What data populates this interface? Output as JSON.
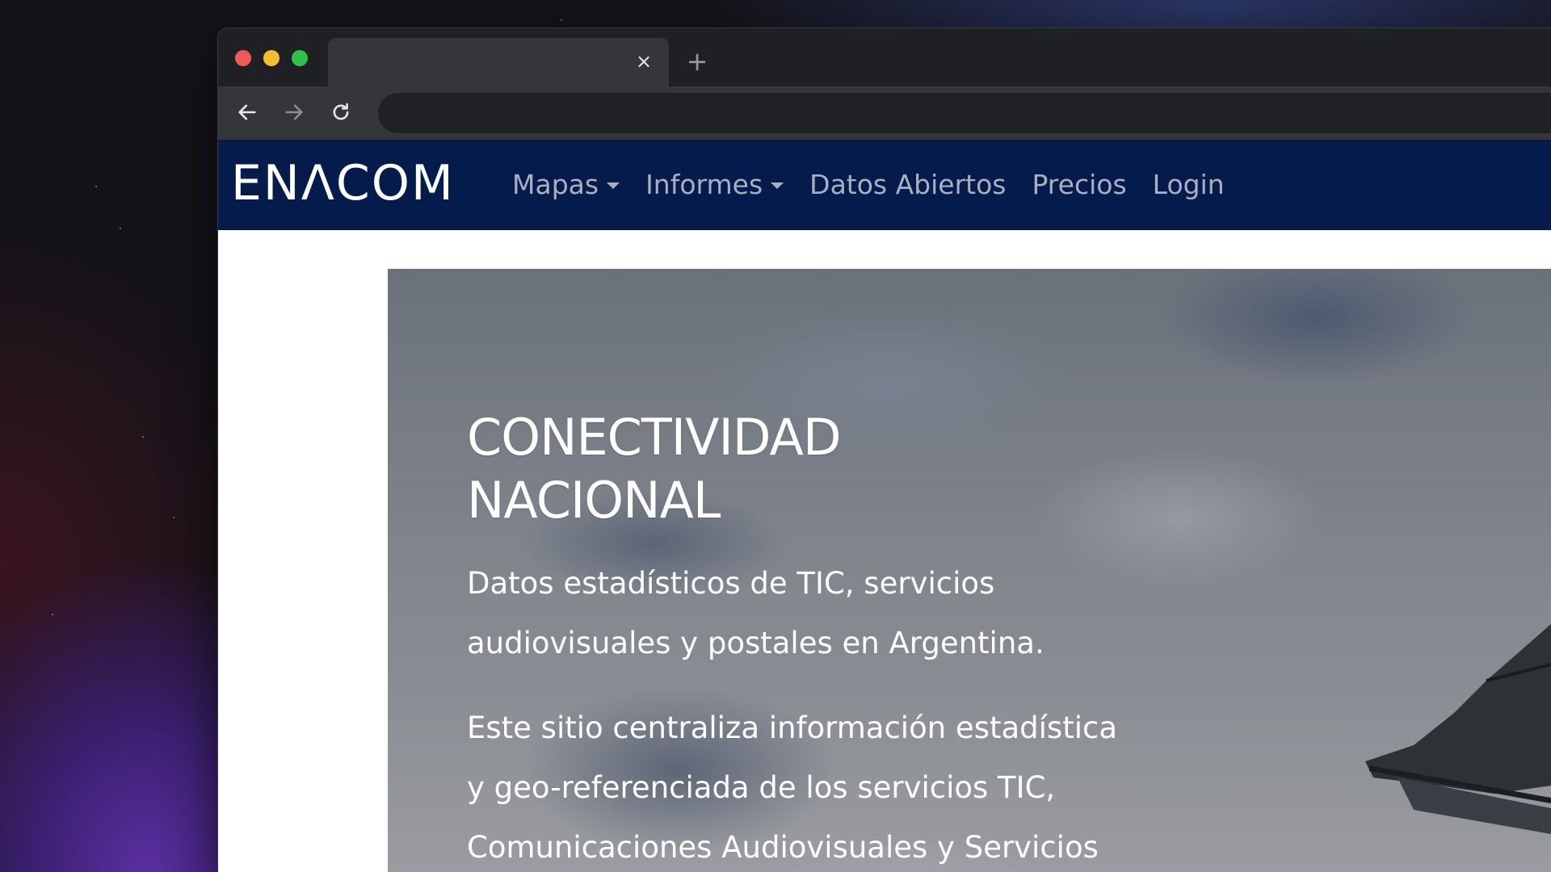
{
  "browser": {
    "tab_close": "×",
    "new_tab": "+"
  },
  "site": {
    "logo_text": "ENΛCOM",
    "nav": {
      "items": [
        {
          "label": "Mapas",
          "dropdown": true
        },
        {
          "label": "Informes",
          "dropdown": true
        },
        {
          "label": "Datos Abiertos",
          "dropdown": false
        },
        {
          "label": "Precios",
          "dropdown": false
        },
        {
          "label": "Login",
          "dropdown": false
        }
      ]
    },
    "hero": {
      "title_line1": "CONECTIVIDAD",
      "title_line2": "NACIONAL",
      "subtitle_line1": "Datos estadísticos de TIC, servicios",
      "subtitle_line2": "audiovisuales y postales en Argentina.",
      "body_line1": "Este sitio centraliza información estadística",
      "body_line2": "y geo-referenciada de los servicios TIC,",
      "body_line3": "Comunicaciones Audiovisuales y Servicios"
    }
  },
  "colors": {
    "nav_background": "#041b4b",
    "nav_link": "#a8b0c2",
    "traffic_red": "#ee5b55",
    "traffic_yellow": "#f4bd30",
    "traffic_green": "#2ec248"
  },
  "icons": {
    "back": "arrow-left-icon",
    "forward": "arrow-right-icon",
    "reload": "reload-icon",
    "close": "close-icon",
    "new_tab": "plus-icon",
    "dropdown": "caret-down-icon"
  }
}
